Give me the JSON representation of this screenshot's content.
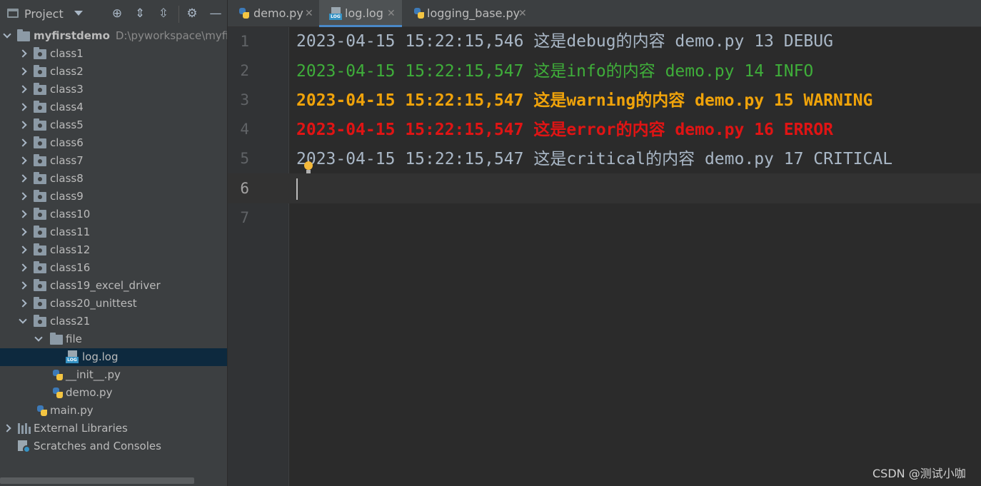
{
  "project_panel": {
    "title": "Project",
    "header_icons": [
      "target-icon",
      "expand-all-icon",
      "collapse-all-icon",
      "gear-icon",
      "minimize-icon"
    ],
    "root": {
      "name": "myfirstdemo",
      "path": "D:\\pyworkspace\\myfirs"
    },
    "items": [
      {
        "label": "class1"
      },
      {
        "label": "class2"
      },
      {
        "label": "class3"
      },
      {
        "label": "class4"
      },
      {
        "label": "class5"
      },
      {
        "label": "class6"
      },
      {
        "label": "class7"
      },
      {
        "label": "class8"
      },
      {
        "label": "class9"
      },
      {
        "label": "class10"
      },
      {
        "label": "class11"
      },
      {
        "label": "class12"
      },
      {
        "label": "class16"
      },
      {
        "label": "class19_excel_driver"
      },
      {
        "label": "class20_unittest"
      },
      {
        "label": "class21"
      },
      {
        "label": "file"
      },
      {
        "label": "log.log"
      },
      {
        "label": "__init__.py"
      },
      {
        "label": "demo.py"
      },
      {
        "label": "main.py"
      },
      {
        "label": "External Libraries"
      },
      {
        "label": "Scratches and Consoles"
      }
    ]
  },
  "tabs": [
    {
      "label": "demo.py",
      "icon": "python-file-icon"
    },
    {
      "label": "log.log",
      "icon": "log-file-icon",
      "active": true
    },
    {
      "label": "logging_base.py",
      "icon": "python-file-icon"
    }
  ],
  "editor": {
    "line_numbers": [
      "1",
      "2",
      "3",
      "4",
      "5",
      "6",
      "7"
    ],
    "current_line": "6",
    "lines": [
      {
        "text": "2023-04-15 15:22:15,546 这是debug的内容 demo.py 13 DEBUG",
        "level": "debug",
        "color": "#a9b7c6"
      },
      {
        "text": "2023-04-15 15:22:15,547 这是info的内容 demo.py 14 INFO",
        "level": "info",
        "color": "#3fae3a"
      },
      {
        "text": "2023-04-15 15:22:15,547 这是warning的内容 demo.py 15 WARNING",
        "level": "warning",
        "color": "#f0a30a"
      },
      {
        "text": "2023-04-15 15:22:15,547 这是error的内容 demo.py 16 ERROR",
        "level": "error",
        "color": "#e01414"
      },
      {
        "text": "2023-04-15 15:22:15,547 这是critical的内容 demo.py 17 CRITICAL",
        "level": "critical",
        "color": "#a9b7c6"
      }
    ]
  },
  "watermark": "CSDN @测试小咖"
}
